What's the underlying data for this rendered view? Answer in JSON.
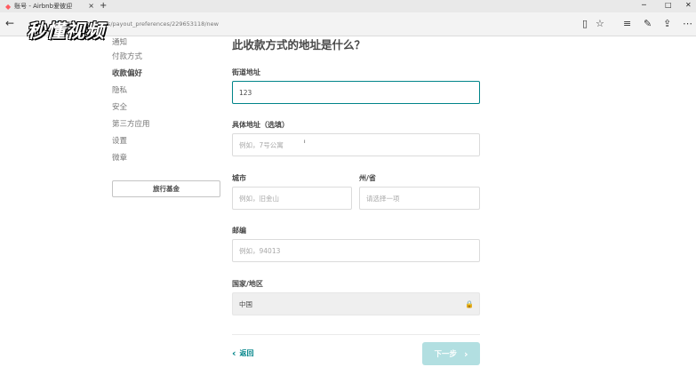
{
  "browser": {
    "tab_title": "账号 - Airbnb爱彼迎",
    "new_tab": "+",
    "url_host": "airbnb.cn",
    "url_path": "/users/payout_preferences/229653118/new",
    "watermark": "秒懂视频"
  },
  "sidebar": {
    "items": [
      {
        "label": "通知",
        "active": false
      },
      {
        "label": "付款方式",
        "active": false
      },
      {
        "label": "收款偏好",
        "active": true
      },
      {
        "label": "隐私",
        "active": false
      },
      {
        "label": "安全",
        "active": false
      },
      {
        "label": "第三方应用",
        "active": false
      },
      {
        "label": "设置",
        "active": false
      },
      {
        "label": "微章",
        "active": false
      }
    ],
    "button_label": "旅行基金"
  },
  "form": {
    "heading": "此收款方式的地址是什么？",
    "street": {
      "label": "街道地址",
      "value": "123"
    },
    "apt": {
      "label": "具体地址（选填）",
      "placeholder": "例如，7号公寓"
    },
    "city": {
      "label": "城市",
      "placeholder": "例如，旧金山"
    },
    "state": {
      "label": "州/省",
      "placeholder": "请选择一项"
    },
    "zip": {
      "label": "邮编",
      "placeholder": "例如，94013"
    },
    "country": {
      "label": "国家/地区",
      "value": "中国"
    }
  },
  "footer": {
    "back_label": "返回",
    "next_label": "下一步"
  },
  "colors": {
    "accent": "#008489",
    "next_disabled": "#b2dfe1"
  }
}
